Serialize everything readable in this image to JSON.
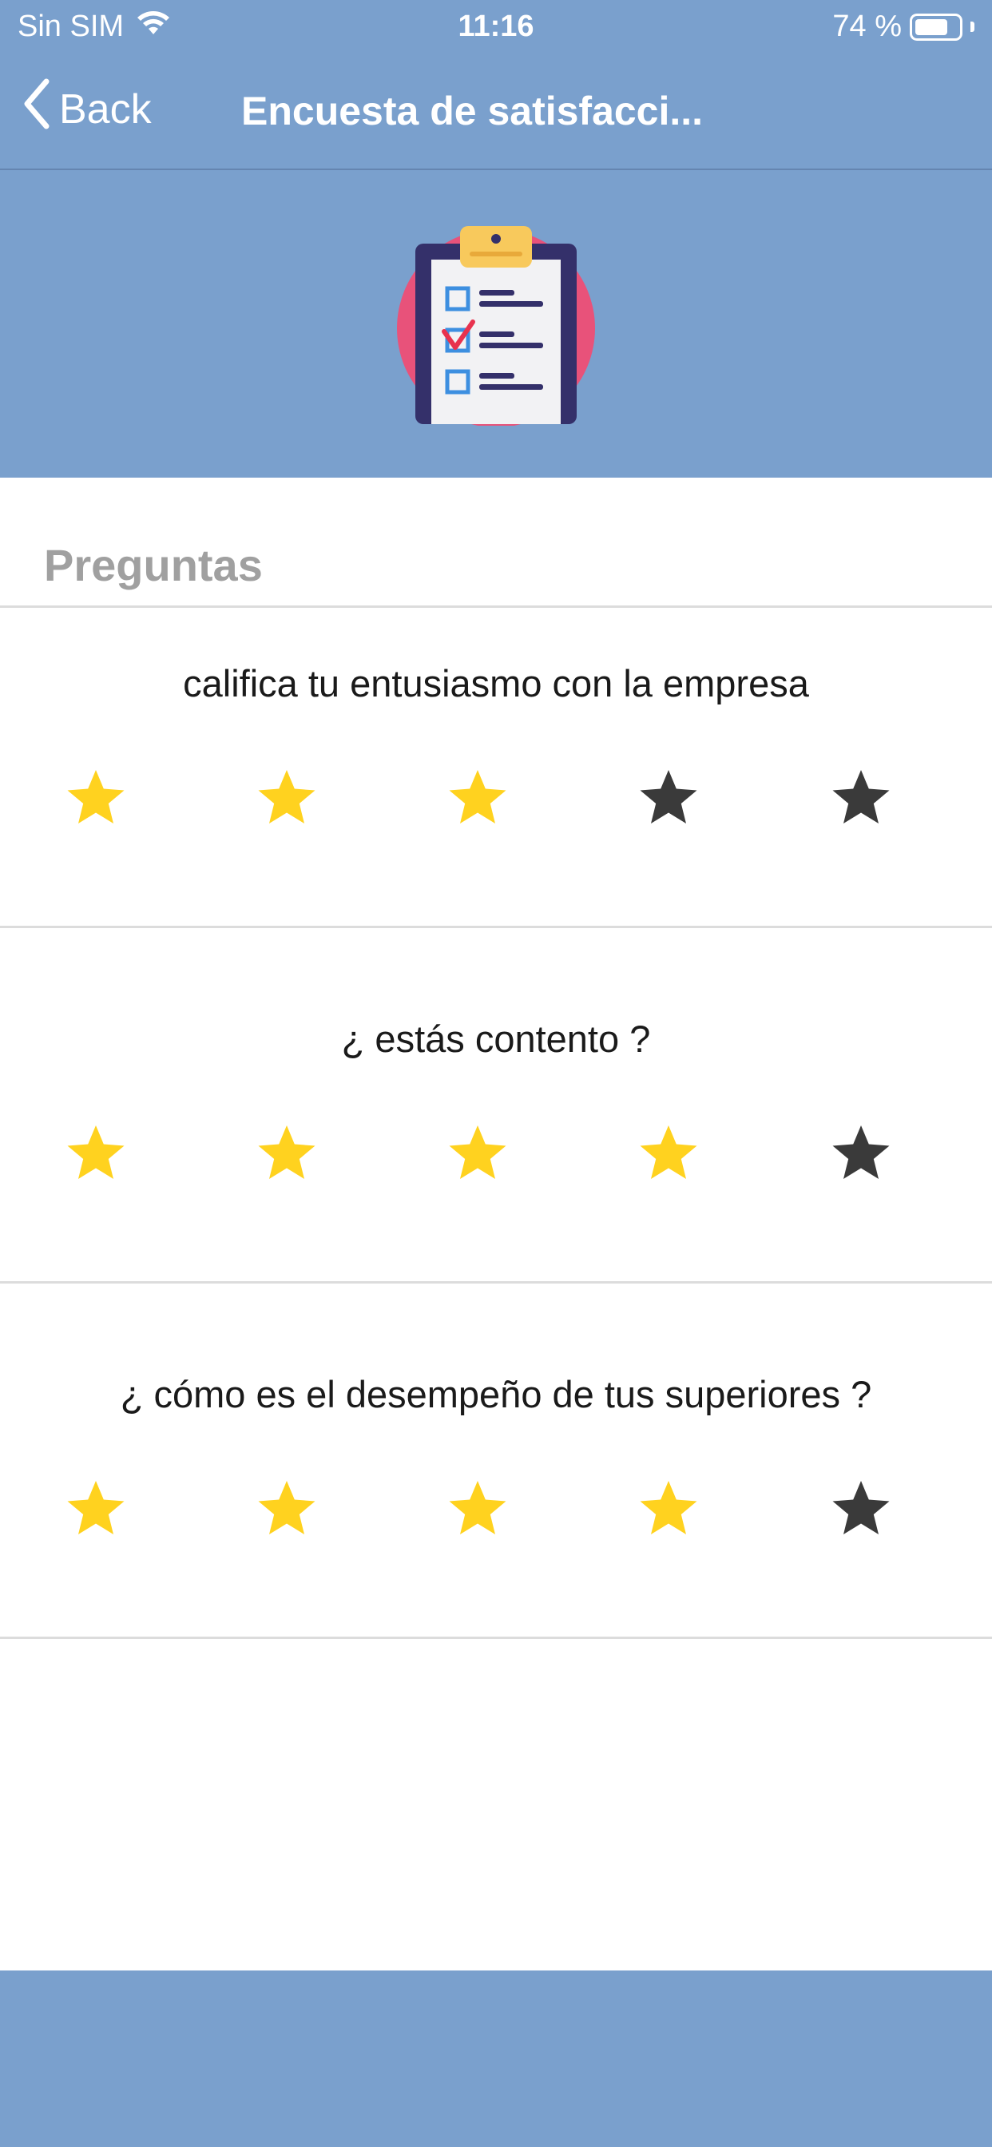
{
  "status_bar": {
    "carrier": "Sin SIM",
    "time": "11:16",
    "battery": "74 %",
    "battery_level": 0.74
  },
  "nav": {
    "back_label": "Back",
    "title": "Encuesta de satisfacci..."
  },
  "section": {
    "title": "Preguntas"
  },
  "questions": [
    {
      "text": "califica tu entusiasmo con la empresa",
      "rating": 3,
      "max": 5
    },
    {
      "text": "¿ estás contento ?",
      "rating": 4,
      "max": 5
    },
    {
      "text": "¿ cómo es el desempeño de tus superiores ?",
      "rating": 4,
      "max": 5
    }
  ],
  "colors": {
    "header": "#7aa0cd",
    "star_filled": "#ffd21f",
    "star_empty": "#3a3a3a",
    "section_title": "#a0a0a0"
  },
  "icons": {
    "wifi": "wifi-icon",
    "battery": "battery-icon",
    "back": "chevron-left-icon",
    "survey": "clipboard-checklist-icon",
    "star": "star-icon"
  }
}
